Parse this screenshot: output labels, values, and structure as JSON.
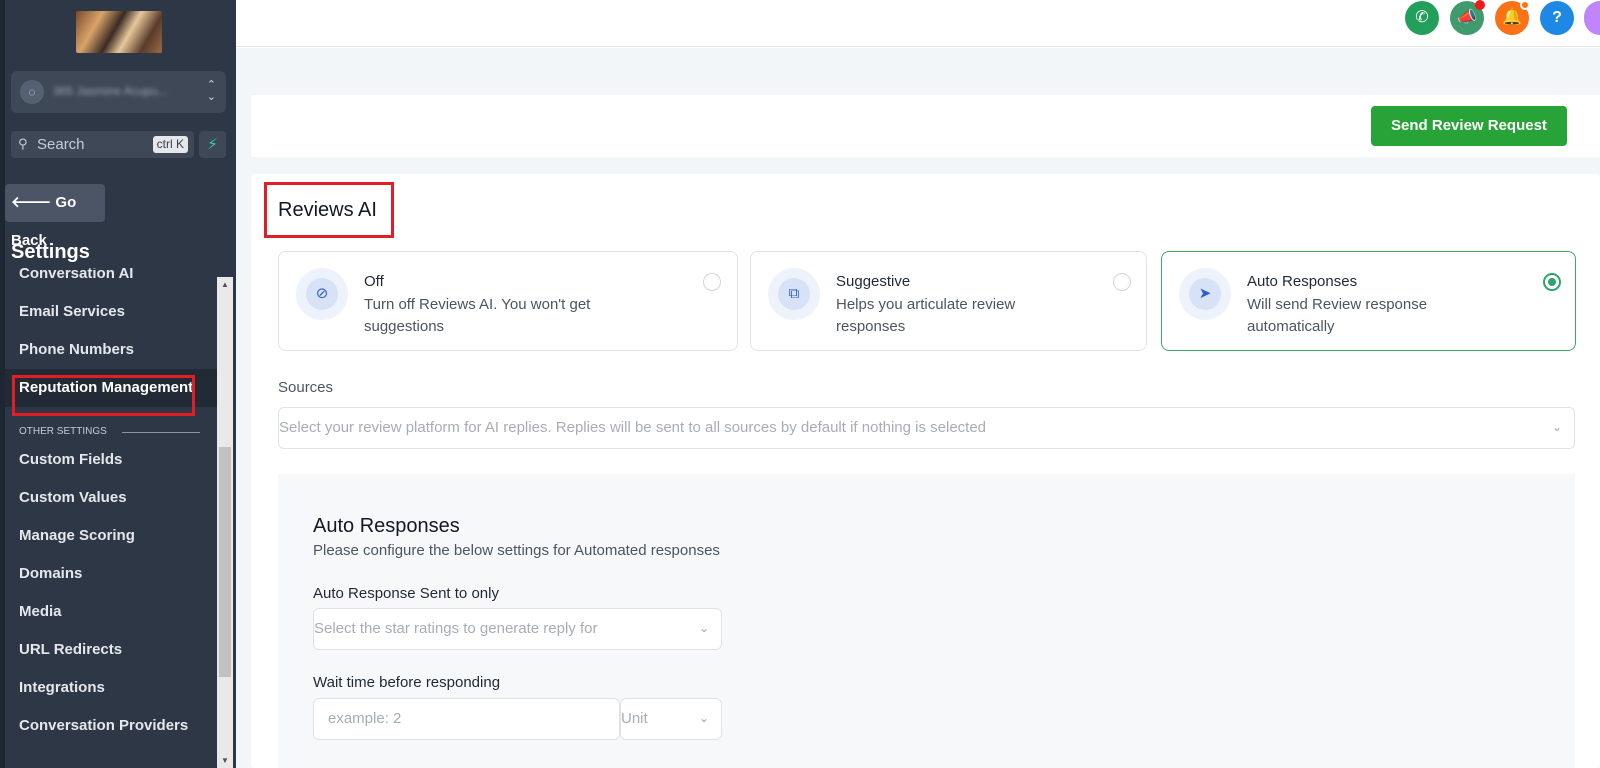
{
  "sidebar": {
    "account_name": "365 Jasmine Acupu...",
    "search": {
      "placeholder": "Search",
      "shortcut": "ctrl K"
    },
    "go_back": "Go Back",
    "settings_title": "Settings",
    "items": [
      {
        "label": "Conversation AI"
      },
      {
        "label": "Email Services"
      },
      {
        "label": "Phone Numbers"
      },
      {
        "label": "Reputation Management",
        "active": true
      }
    ],
    "other_settings_label": "OTHER SETTINGS",
    "other_items": [
      {
        "label": "Custom Fields"
      },
      {
        "label": "Custom Values"
      },
      {
        "label": "Manage Scoring"
      },
      {
        "label": "Domains"
      },
      {
        "label": "Media"
      },
      {
        "label": "URL Redirects"
      },
      {
        "label": "Integrations"
      },
      {
        "label": "Conversation Providers"
      }
    ]
  },
  "topbar": {
    "buttons": [
      {
        "icon": "phone-icon",
        "color": "#22a05b"
      },
      {
        "icon": "megaphone-icon",
        "color": "#3f9a6d"
      },
      {
        "icon": "bell-icon",
        "color": "#f97316"
      },
      {
        "icon": "help-icon",
        "color": "#1e88e5",
        "glyph": "?"
      }
    ]
  },
  "header": {
    "send_review_request": "Send Review Request"
  },
  "reviews_ai": {
    "title": "Reviews AI",
    "options": [
      {
        "title": "Off",
        "description": "Turn off Reviews AI. You won't get suggestions",
        "selected": false,
        "icon": "bot-off-icon"
      },
      {
        "title": "Suggestive",
        "description": "Helps you articulate review responses",
        "selected": false,
        "icon": "chat-bubbles-icon"
      },
      {
        "title": "Auto Responses",
        "description": "Will send Review response automatically",
        "selected": true,
        "icon": "send-icon"
      }
    ],
    "sources": {
      "label": "Sources",
      "placeholder": "Select your review platform for AI replies. Replies will be sent to all sources by default if nothing is selected"
    }
  },
  "auto_responses": {
    "title": "Auto Responses",
    "subtitle": "Please configure the below settings for Automated responses",
    "sent_to_label": "Auto Response Sent to only",
    "sent_to_placeholder": "Select the star ratings to generate reply for",
    "wait_label": "Wait time before responding",
    "wait_placeholder": "example: 2",
    "unit_placeholder": "Unit"
  },
  "colors": {
    "primary_green": "#27a338",
    "selected_border": "#3fa96a",
    "highlight_red": "#e11d26",
    "sidebar_bg": "#2e3746"
  }
}
